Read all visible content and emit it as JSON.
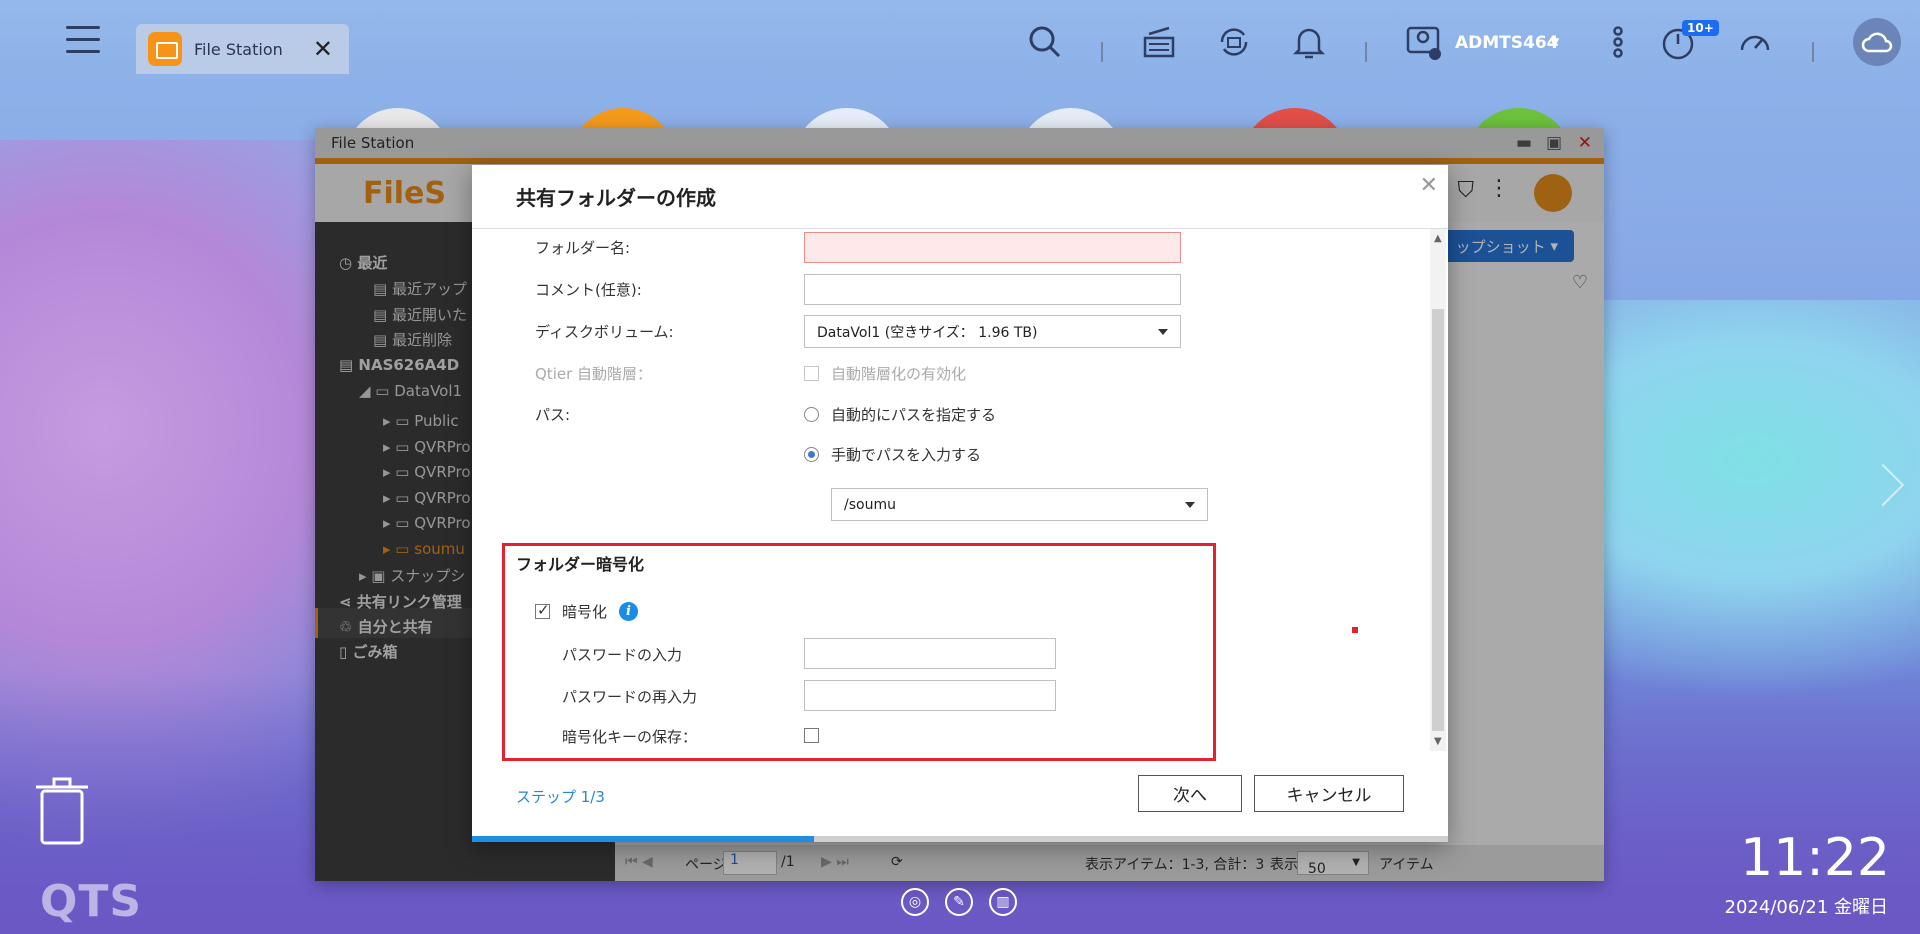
{
  "taskbar": {
    "app_tab_label": "File Station",
    "user_name": "ADMTS464",
    "notification_badge": "10+"
  },
  "file_station": {
    "window_title": "File Station",
    "logo_text": "FileS",
    "snapshot_button": "ップショット",
    "sidebar": {
      "recent": "最近",
      "recent_upload": "最近アップ",
      "recent_open": "最近開いた",
      "recent_delete": "最近削除",
      "nas": "NAS626A4D",
      "datavol": "DataVol1",
      "folders": [
        "Public",
        "QVRPro",
        "QVRPro",
        "QVRPro",
        "QVRPro",
        "soumu"
      ],
      "snapshot": "スナップシ",
      "share_link": "共有リンク管理",
      "shared_with_me": "自分と共有",
      "trash": "ごみ箱"
    },
    "footer": {
      "page_label": "ページ",
      "page_value": "1",
      "page_total": "/1",
      "items_info": "表示アイテム：1-3, 合計：3",
      "display_label": "表示",
      "per_page": "50",
      "items_label": "アイテム"
    }
  },
  "modal": {
    "title": "共有フォルダーの作成",
    "folder_name_label": "フォルダー名:",
    "comment_label": "コメント(任意):",
    "disk_volume_label": "ディスクボリューム:",
    "disk_volume_value": "DataVol1 (空きサイズ： 1.96 TB)",
    "qtier_label": "Qtier 自動階層：",
    "qtier_option": "自動階層化の有効化",
    "path_label": "パス:",
    "path_auto": "自動的にパスを指定する",
    "path_manual": "手動でパスを入力する",
    "path_value": "/soumu",
    "encryption_section": "フォルダー暗号化",
    "encrypt_label": "暗号化",
    "password_label": "パスワードの入力",
    "password_confirm_label": "パスワードの再入力",
    "save_key_label": "暗号化キーの保存：",
    "step_text": "ステップ 1/3",
    "next_button": "次へ",
    "cancel_button": "キャンセル",
    "progress": 0.35
  },
  "desktop": {
    "brand": "QTS",
    "time": "11:22",
    "date": "2024/06/21 金曜日"
  },
  "colors": {
    "accent_orange": "#e58b1b",
    "highlight_red": "#e0242f",
    "link_blue": "#2a86d5"
  }
}
